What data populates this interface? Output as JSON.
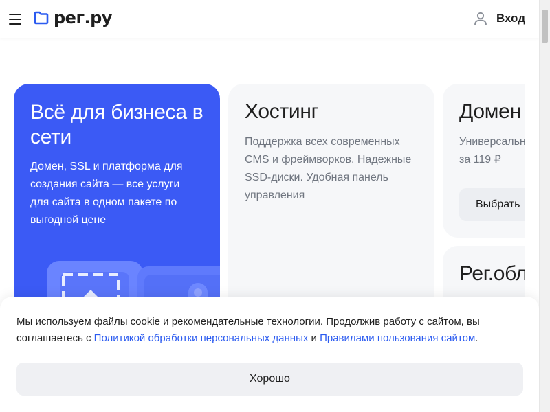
{
  "header": {
    "logo_text": "рег.ру",
    "login_label": "Вход"
  },
  "cards": {
    "main": {
      "title": "Всё для бизнеса в сети",
      "description": "Домен, SSL и платформа для создания сайта — все услуги для сайта в одном пакете по выгодной цене"
    },
    "hosting": {
      "title": "Хостинг",
      "description": "Поддержка всех современных CMS и фреймворков. Надежные SSD-диски. Удобная панель управления"
    },
    "domain": {
      "title": "Домен",
      "description_line1": "Универсальн",
      "description_line2": "за 119 ₽",
      "button_label": "Выбрать"
    },
    "cloud": {
      "title": "Рег.обл"
    }
  },
  "cookie": {
    "text_part1": "Мы используем файлы cookie и рекомендательные технологии. Продолжив работу с сайтом, вы соглашаетесь с ",
    "link_privacy": "Политикой обработки персональных данных",
    "text_and": " и ",
    "link_terms": "Правилами пользования сайтом",
    "text_end": ".",
    "button_label": "Хорошо"
  },
  "colors": {
    "accent": "#3b5af5",
    "link": "#2b5bf0"
  }
}
